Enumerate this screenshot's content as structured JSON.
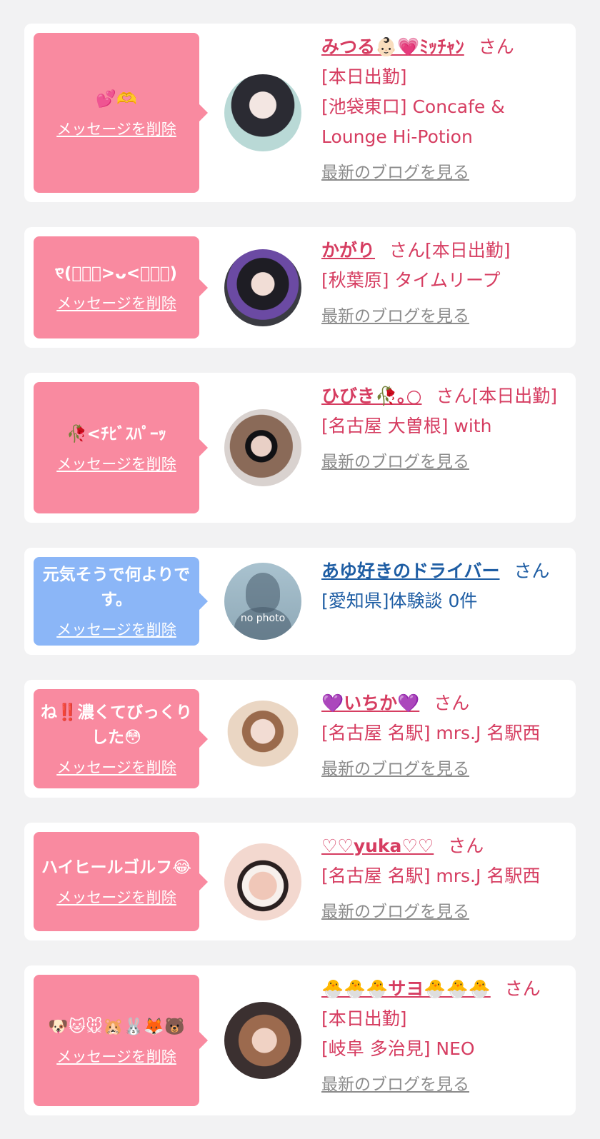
{
  "delete_label": "メッセージを削除",
  "blog_label": "最新のブログを見る",
  "san": "さん",
  "no_photo": "no photo",
  "colors": {
    "pink": "#f98aa0",
    "blue": "#8bb6f7",
    "name_pink": "#d63d61",
    "name_blue": "#1f5ea4"
  },
  "cards": [
    {
      "message": "💕🫶",
      "name": "みつる👶🏻💗ﾐｯﾁｬﾝ",
      "status": "[本日出勤]",
      "shop": "[池袋東口] Concafe & Lounge Hi-Potion"
    },
    {
      "message": "୧⃛(๑⃙⃘>ᴗ<๑⃙⃘)",
      "name": "かがり",
      "status": "[本日出勤]",
      "shop": "[秋葉原] タイムリープ"
    },
    {
      "message": "🥀<ﾁﾋﾞｽﾊﾟｰｯ",
      "name": "ひびき🥀｡○",
      "status": "[本日出勤]",
      "shop": "[名古屋 大曽根] with"
    },
    {
      "message": "元気そうで何よりです。",
      "name": "あゆ好きのドライバー",
      "shop": "[愛知県]体験談 0件"
    },
    {
      "message": "ね‼️濃くてびっくりした😳",
      "name": "💜いちか💜",
      "shop": "[名古屋 名駅] mrs.J 名駅西"
    },
    {
      "message": "ハイヒールゴルフ😂",
      "name": "♡♡yuka♡♡",
      "shop": "[名古屋 名駅] mrs.J 名駅西"
    },
    {
      "message": "🐶🐱🐭🐹🐰🦊🐻",
      "name": "🐣🐣🐣サヨ🐣🐣🐣",
      "status": "[本日出勤]",
      "shop": "[岐阜 多治見] NEO"
    }
  ]
}
